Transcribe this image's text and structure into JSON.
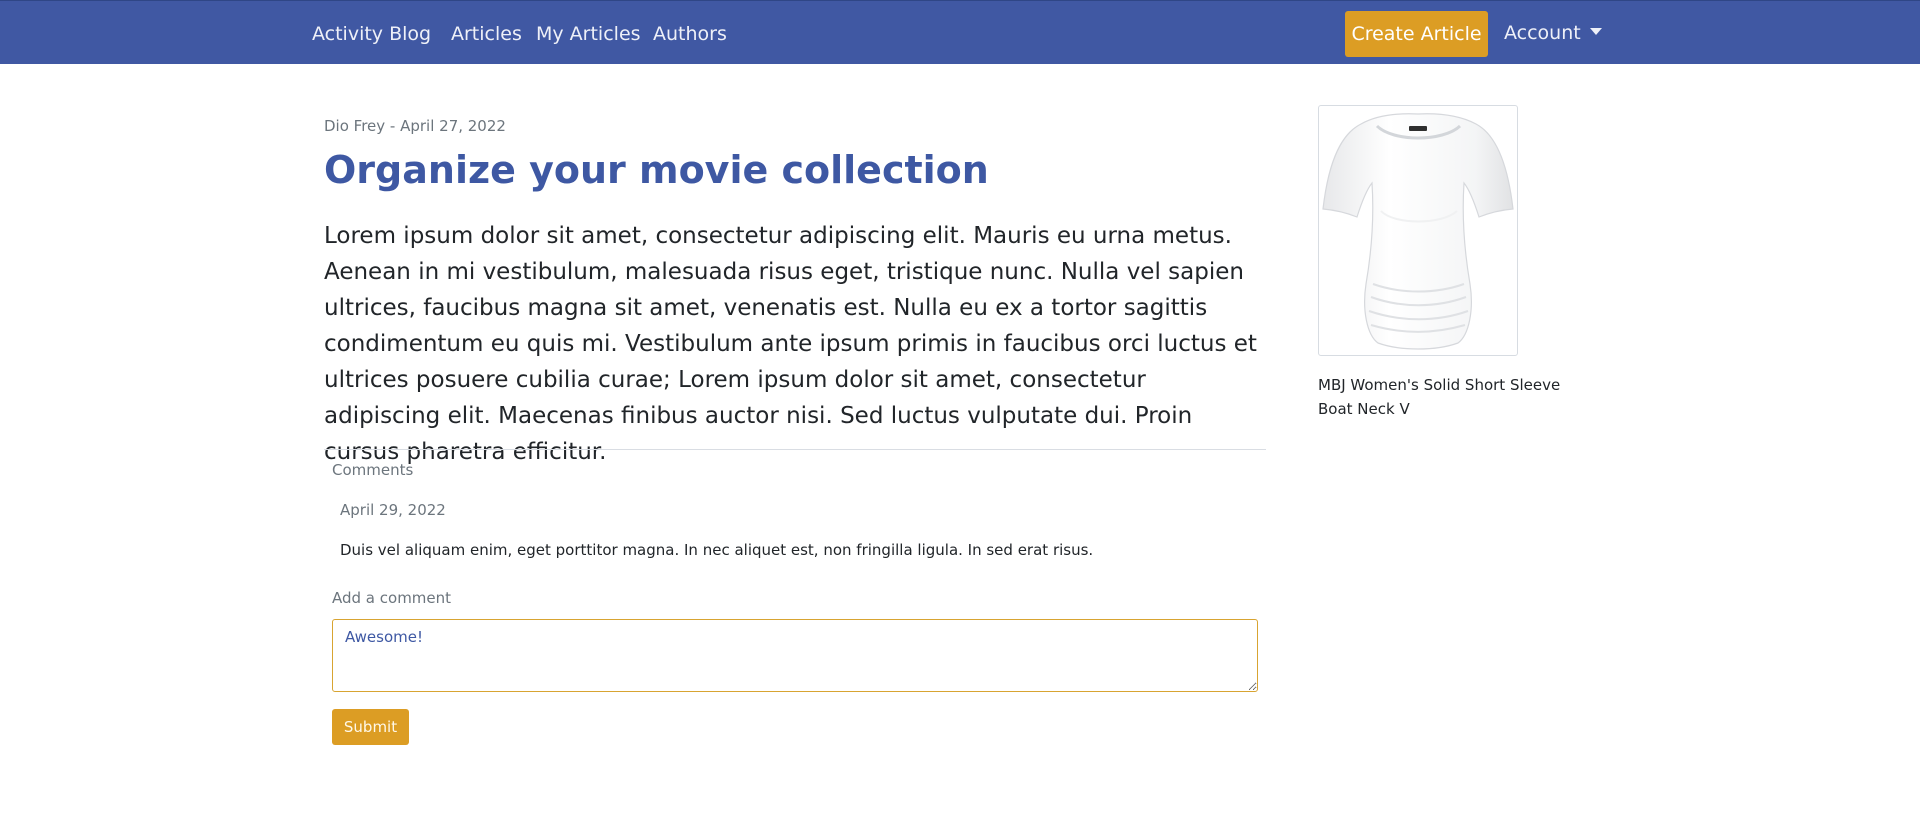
{
  "nav": {
    "brand": "Activity Blog",
    "links": [
      "Articles",
      "My Articles",
      "Authors"
    ],
    "create_label": "Create Article",
    "account_label": "Account"
  },
  "article": {
    "meta": "Dio Frey - April 27, 2022",
    "title": "Organize your movie collection",
    "body": "Lorem ipsum dolor sit amet, consectetur adipiscing elit. Mauris eu urna metus. Aenean in mi vestibulum, malesuada risus eget, tristique nunc. Nulla vel sapien ultrices, faucibus magna sit amet, venenatis est. Nulla eu ex a tortor sagittis condimentum eu quis mi. Vestibulum ante ipsum primis in faucibus orci luctus et ultrices posuere cubilia curae; Lorem ipsum dolor sit amet, consectetur adipiscing elit. Maecenas finibus auctor nisi. Sed luctus vulputate dui. Proin cursus pharetra efficitur."
  },
  "comments": {
    "label": "Comments",
    "items": [
      {
        "date": "April 29, 2022",
        "text": "Duis vel aliquam enim, eget porttitor magna. In nec aliquet est, non fringilla ligula. In sed erat risus."
      }
    ],
    "add_label": "Add a comment",
    "input_value": "Awesome!",
    "submit_label": "Submit"
  },
  "product": {
    "title": "MBJ Women's Solid Short Sleeve Boat Neck V",
    "image_icon": "white-t-shirt-image"
  },
  "colors": {
    "navbar": "#4058a3",
    "accent": "#dc9d24",
    "title": "#3e58a3"
  }
}
